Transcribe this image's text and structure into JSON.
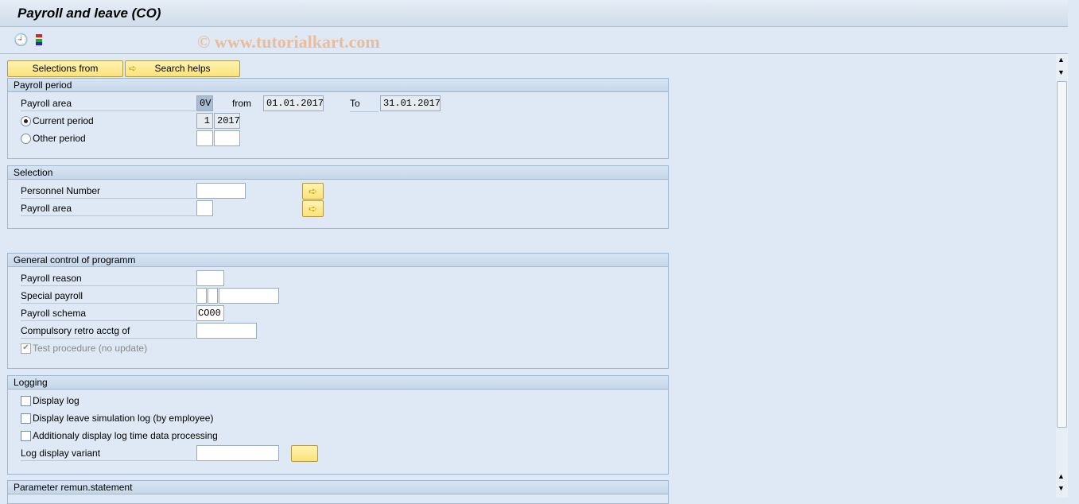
{
  "window": {
    "title": "Payroll and leave (CO)"
  },
  "toolbar": {
    "icons": [
      "execute-clock-icon",
      "variant-icon"
    ],
    "watermark": "© www.tutorialkart.com"
  },
  "buttons": {
    "selections_from": "Selections from",
    "search_helps": "Search helps"
  },
  "payroll_period": {
    "header": "Payroll period",
    "payroll_area_label": "Payroll area",
    "payroll_area_value": "0V",
    "from_label": "from",
    "from_value": "01.01.2017",
    "to_label": "To",
    "to_value": "31.01.2017",
    "current_period_label": "Current period",
    "current_period_num": "1",
    "current_period_year": "2017",
    "other_period_label": "Other period",
    "selected": "current"
  },
  "selection": {
    "header": "Selection",
    "personnel_number_label": "Personnel Number",
    "payroll_area_label": "Payroll area"
  },
  "general": {
    "header": "General control of programm",
    "payroll_reason_label": "Payroll reason",
    "special_payroll_label": "Special payroll",
    "payroll_schema_label": "Payroll schema",
    "payroll_schema_value": "CO00",
    "retro_label": "Compulsory retro acctg of",
    "test_label": "Test procedure (no update)",
    "test_checked": true
  },
  "logging": {
    "header": "Logging",
    "display_log": "Display log",
    "display_leave_sim": "Display leave simulation log (by employee)",
    "additional_log": "Additionaly display log time data processing",
    "variant_label": "Log display variant"
  },
  "remun": {
    "header": "Parameter remun.statement"
  }
}
